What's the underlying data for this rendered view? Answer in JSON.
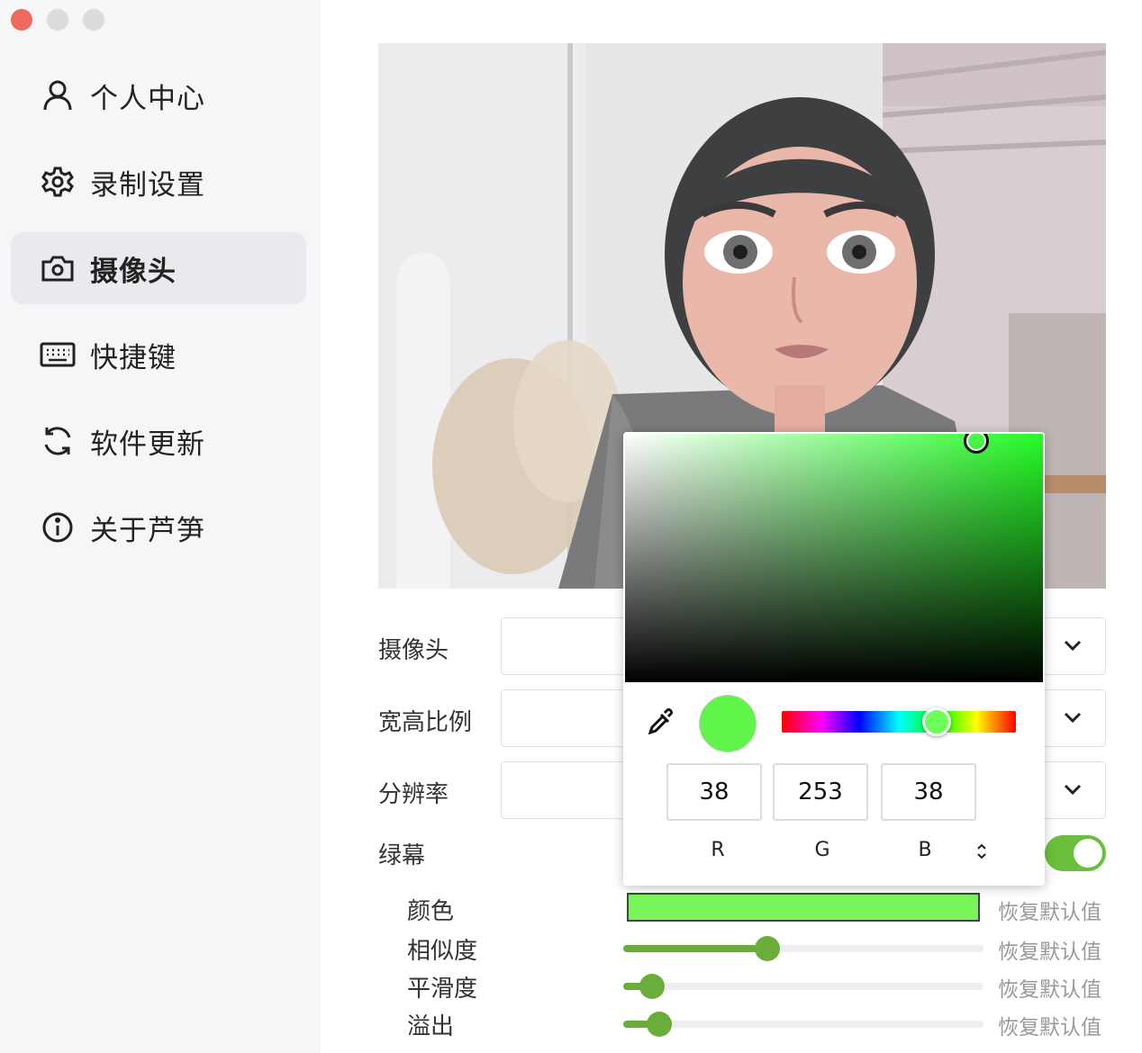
{
  "sidebar": {
    "items": [
      {
        "label": "个人中心",
        "icon": "user-icon"
      },
      {
        "label": "录制设置",
        "icon": "gear-icon"
      },
      {
        "label": "摄像头",
        "icon": "camera-icon",
        "active": true
      },
      {
        "label": "快捷键",
        "icon": "keyboard-icon"
      },
      {
        "label": "软件更新",
        "icon": "refresh-icon"
      },
      {
        "label": "关于芦笋",
        "icon": "info-icon"
      }
    ]
  },
  "settings": {
    "camera_label": "摄像头",
    "aspect_label": "宽高比例",
    "resolution_label": "分辨率",
    "greenscreen_label": "绿幕",
    "greenscreen_on": true,
    "color_label": "颜色",
    "similarity_label": "相似度",
    "smoothness_label": "平滑度",
    "spill_label": "溢出",
    "reset_label": "恢复默认值",
    "similarity_value": 0.4,
    "smoothness_value": 0.08,
    "spill_value": 0.1,
    "color_hex": "#79f55a"
  },
  "picker": {
    "r": "38",
    "g": "253",
    "b": "38",
    "r_label": "R",
    "g_label": "G",
    "b_label": "B",
    "hex": "#26fd26"
  }
}
